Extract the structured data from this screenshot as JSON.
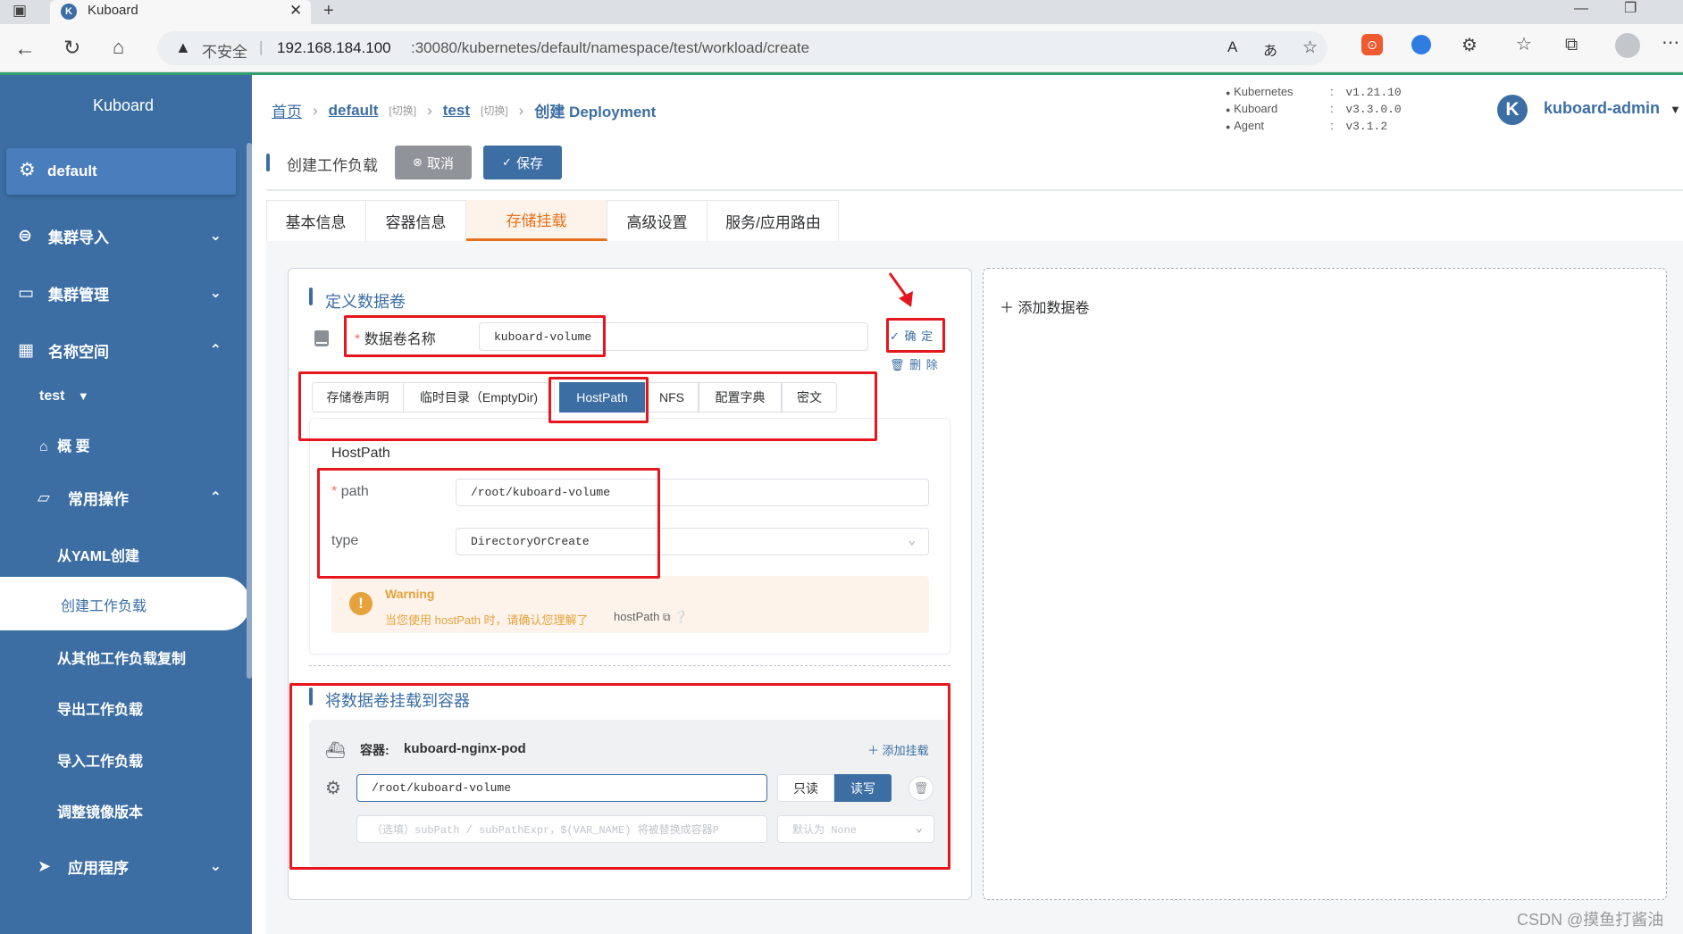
{
  "browser": {
    "tab_title": "Kuboard",
    "url_warning": "不安全",
    "url_host": "192.168.184.100",
    "url_rest": ":30080/kubernetes/default/namespace/test/workload/create"
  },
  "sidebar": {
    "brand": "Kuboard",
    "cluster": "default",
    "items": [
      {
        "label": "集群导入"
      },
      {
        "label": "集群管理"
      },
      {
        "label": "名称空间"
      }
    ],
    "namespace": "test",
    "overview": "概 要",
    "common_ops": "常用操作",
    "sub_items": [
      "从YAML创建",
      "创建工作负载",
      "从其他工作负载复制",
      "导出工作负载",
      "导入工作负载",
      "调整镜像版本"
    ],
    "apps": "应用程序"
  },
  "breadcrumb": {
    "home": "首页",
    "cluster": "default",
    "switch1": "[切换]",
    "namespace": "test",
    "switch2": "[切换]",
    "current": "创建 Deployment"
  },
  "versions": [
    {
      "name": "Kubernetes",
      "value": "v1.21.10"
    },
    {
      "name": "Kuboard",
      "value": "v3.3.0.0"
    },
    {
      "name": "Agent",
      "value": "v3.1.2"
    }
  ],
  "user": {
    "initial": "K",
    "name": "kuboard-admin"
  },
  "toolbar": {
    "title": "创建工作负载",
    "cancel": "取消",
    "save": "保存"
  },
  "tabs": [
    "基本信息",
    "容器信息",
    "存储挂载",
    "高级设置",
    "服务/应用路由"
  ],
  "volume": {
    "section_title": "定义数据卷",
    "name_label": "数据卷名称",
    "name_value": "kuboard-volume",
    "confirm": "确 定",
    "delete": "删 除",
    "types": [
      "存储卷声明",
      "临时目录（EmptyDir)",
      "HostPath",
      "NFS",
      "配置字典",
      "密文"
    ],
    "hostpath_title": "HostPath",
    "path_label": "path",
    "path_value": "/root/kuboard-volume",
    "type_label": "type",
    "type_value": "DirectoryOrCreate",
    "warning_title": "Warning",
    "warning_text": "当您使用 hostPath 时，请确认您理解了",
    "warning_link": "hostPath"
  },
  "add_volume": "添加数据卷",
  "mount": {
    "section_title": "将数据卷挂载到容器",
    "container_label": "容器:",
    "container_name": "kuboard-nginx-pod",
    "add_mount": "添加挂载",
    "mount_path": "/root/kuboard-volume",
    "readonly": "只读",
    "readwrite": "读写",
    "subpath_placeholder": "（选填）subPath / subPathExpr，$(VAR_NAME) 将被替换成容器P",
    "propagation_placeholder": "默认为 None"
  },
  "watermark": "CSDN @摸鱼打酱油",
  "colors": {
    "primary": "#3c6ea4",
    "accent": "#e6701a",
    "warning": "#e6a23c",
    "annotation": "#e5161d"
  }
}
